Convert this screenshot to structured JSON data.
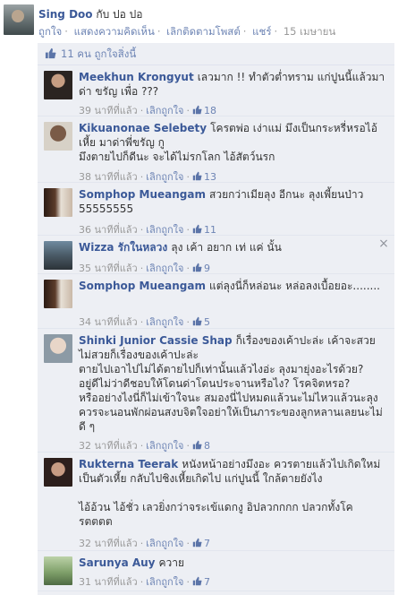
{
  "post": {
    "author": "Sing Doo",
    "with_text": "กับ ปอ ปอ",
    "actions": [
      "ถูกใจ",
      "แสดงความคิดเห็น",
      "เลิกติดตามโพสต์",
      "แชร์"
    ],
    "time": "15 เมษายน"
  },
  "likes": {
    "text": "11 คน ถูกใจสิ่งนี้"
  },
  "comments": [
    {
      "author": "Meekhun Krongyut",
      "text": "เลวมาก !! ทำตัวต่ำทราม แก่ปูนนี้แล้วมาด่า ขรัญ เพื่อ ???",
      "time": "39 นาทีที่แล้ว",
      "action": "เลิกถูกใจ",
      "likes": "18"
    },
    {
      "author": "Kikuanonae Selebety",
      "text": "โครตพ่อ เง่าแม่ มึงเป็นกระหรี่หรอไอ้เหี้ย มาด่าพี่ขรัญ กู\nมึงตายไปก็ดีนะ จะได้ไม่รกโลก ไอ้สัตว์นรก",
      "time": "38 นาทีที่แล้ว",
      "action": "เลิกถูกใจ",
      "likes": "13"
    },
    {
      "author": "Somphop Mueangam",
      "text": "สวยกว่าเมียลุง อีกนะ ลุงเพี้ยนป่าว 55555555",
      "time": "36 นาทีที่แล้ว",
      "action": "เลิกถูกใจ",
      "likes": "11"
    },
    {
      "author": "Wizza รักในหลวง",
      "text": "ลุง เค้า อยาก เท่ แค่ นั้น",
      "time": "35 นาทีที่แล้ว",
      "action": "เลิกถูกใจ",
      "likes": "9"
    },
    {
      "author": "Somphop Mueangam",
      "text": "แต่ลุงนี่ก็หล่อนะ หล่อลงเบื้อยอะ........",
      "time": "34 นาทีที่แล้ว",
      "action": "เลิกถูกใจ",
      "likes": "5"
    },
    {
      "author": "Shinki Junior Cassie Shap",
      "text": "ก็เรื่องของเค้าปะล่ะ เค้าจะสวยไม่สวยก็เรื่องของเค้าปะล่ะ\nตายไปเอาไปไม่ได้ตายไปก็เท่านั้นแล้วไงอ่ะ ลุงมายุ่งอะไรด้วย? อยู่ดีไม่ว่าดีชอบให้โดนด่าโดนประจานหรือไง? โรคจิตหรอ?\nหรืออย่างไงนี่ก็ไม่เข้าใจนะ สมองนี่ไปหมดแล้วนะไม่ไหวแล้วนะลุงควรจะนอนพักผ่อนสงบจิตใจอย่าให้เป็นภาระของลูกหลานเลยนะไม่ดี ๆ",
      "time": "32 นาทีที่แล้ว",
      "action": "เลิกถูกใจ",
      "likes": "8"
    },
    {
      "author": "Rukterna Teerak",
      "text": "หนังหน้าอย่างมึงอะ ควรตายแล้วไปเกิดใหม่เป็นตัวเหี้ย กลับไปชิงเหี้ยเกิดไป แก่ปูนนี้ ใกล้ตายยังไง\n\nไอ้อ้วน ไอ้ชั่ว เลวยิ่งกว่าจระเข้แดกงู อิปลวกกกก ปลวกทั้งโครตตตต",
      "time": "32 นาทีที่แล้ว",
      "action": "เลิกถูกใจ",
      "likes": "7"
    },
    {
      "author": "Sarunya Auy",
      "text": "ควาย",
      "time": "31 นาทีที่แล้ว",
      "action": "เลิกถูกใจ",
      "likes": "7"
    }
  ],
  "colors": {
    "link": "#3b5998",
    "muted": "#999999",
    "feed_bg": "#edeff4"
  }
}
